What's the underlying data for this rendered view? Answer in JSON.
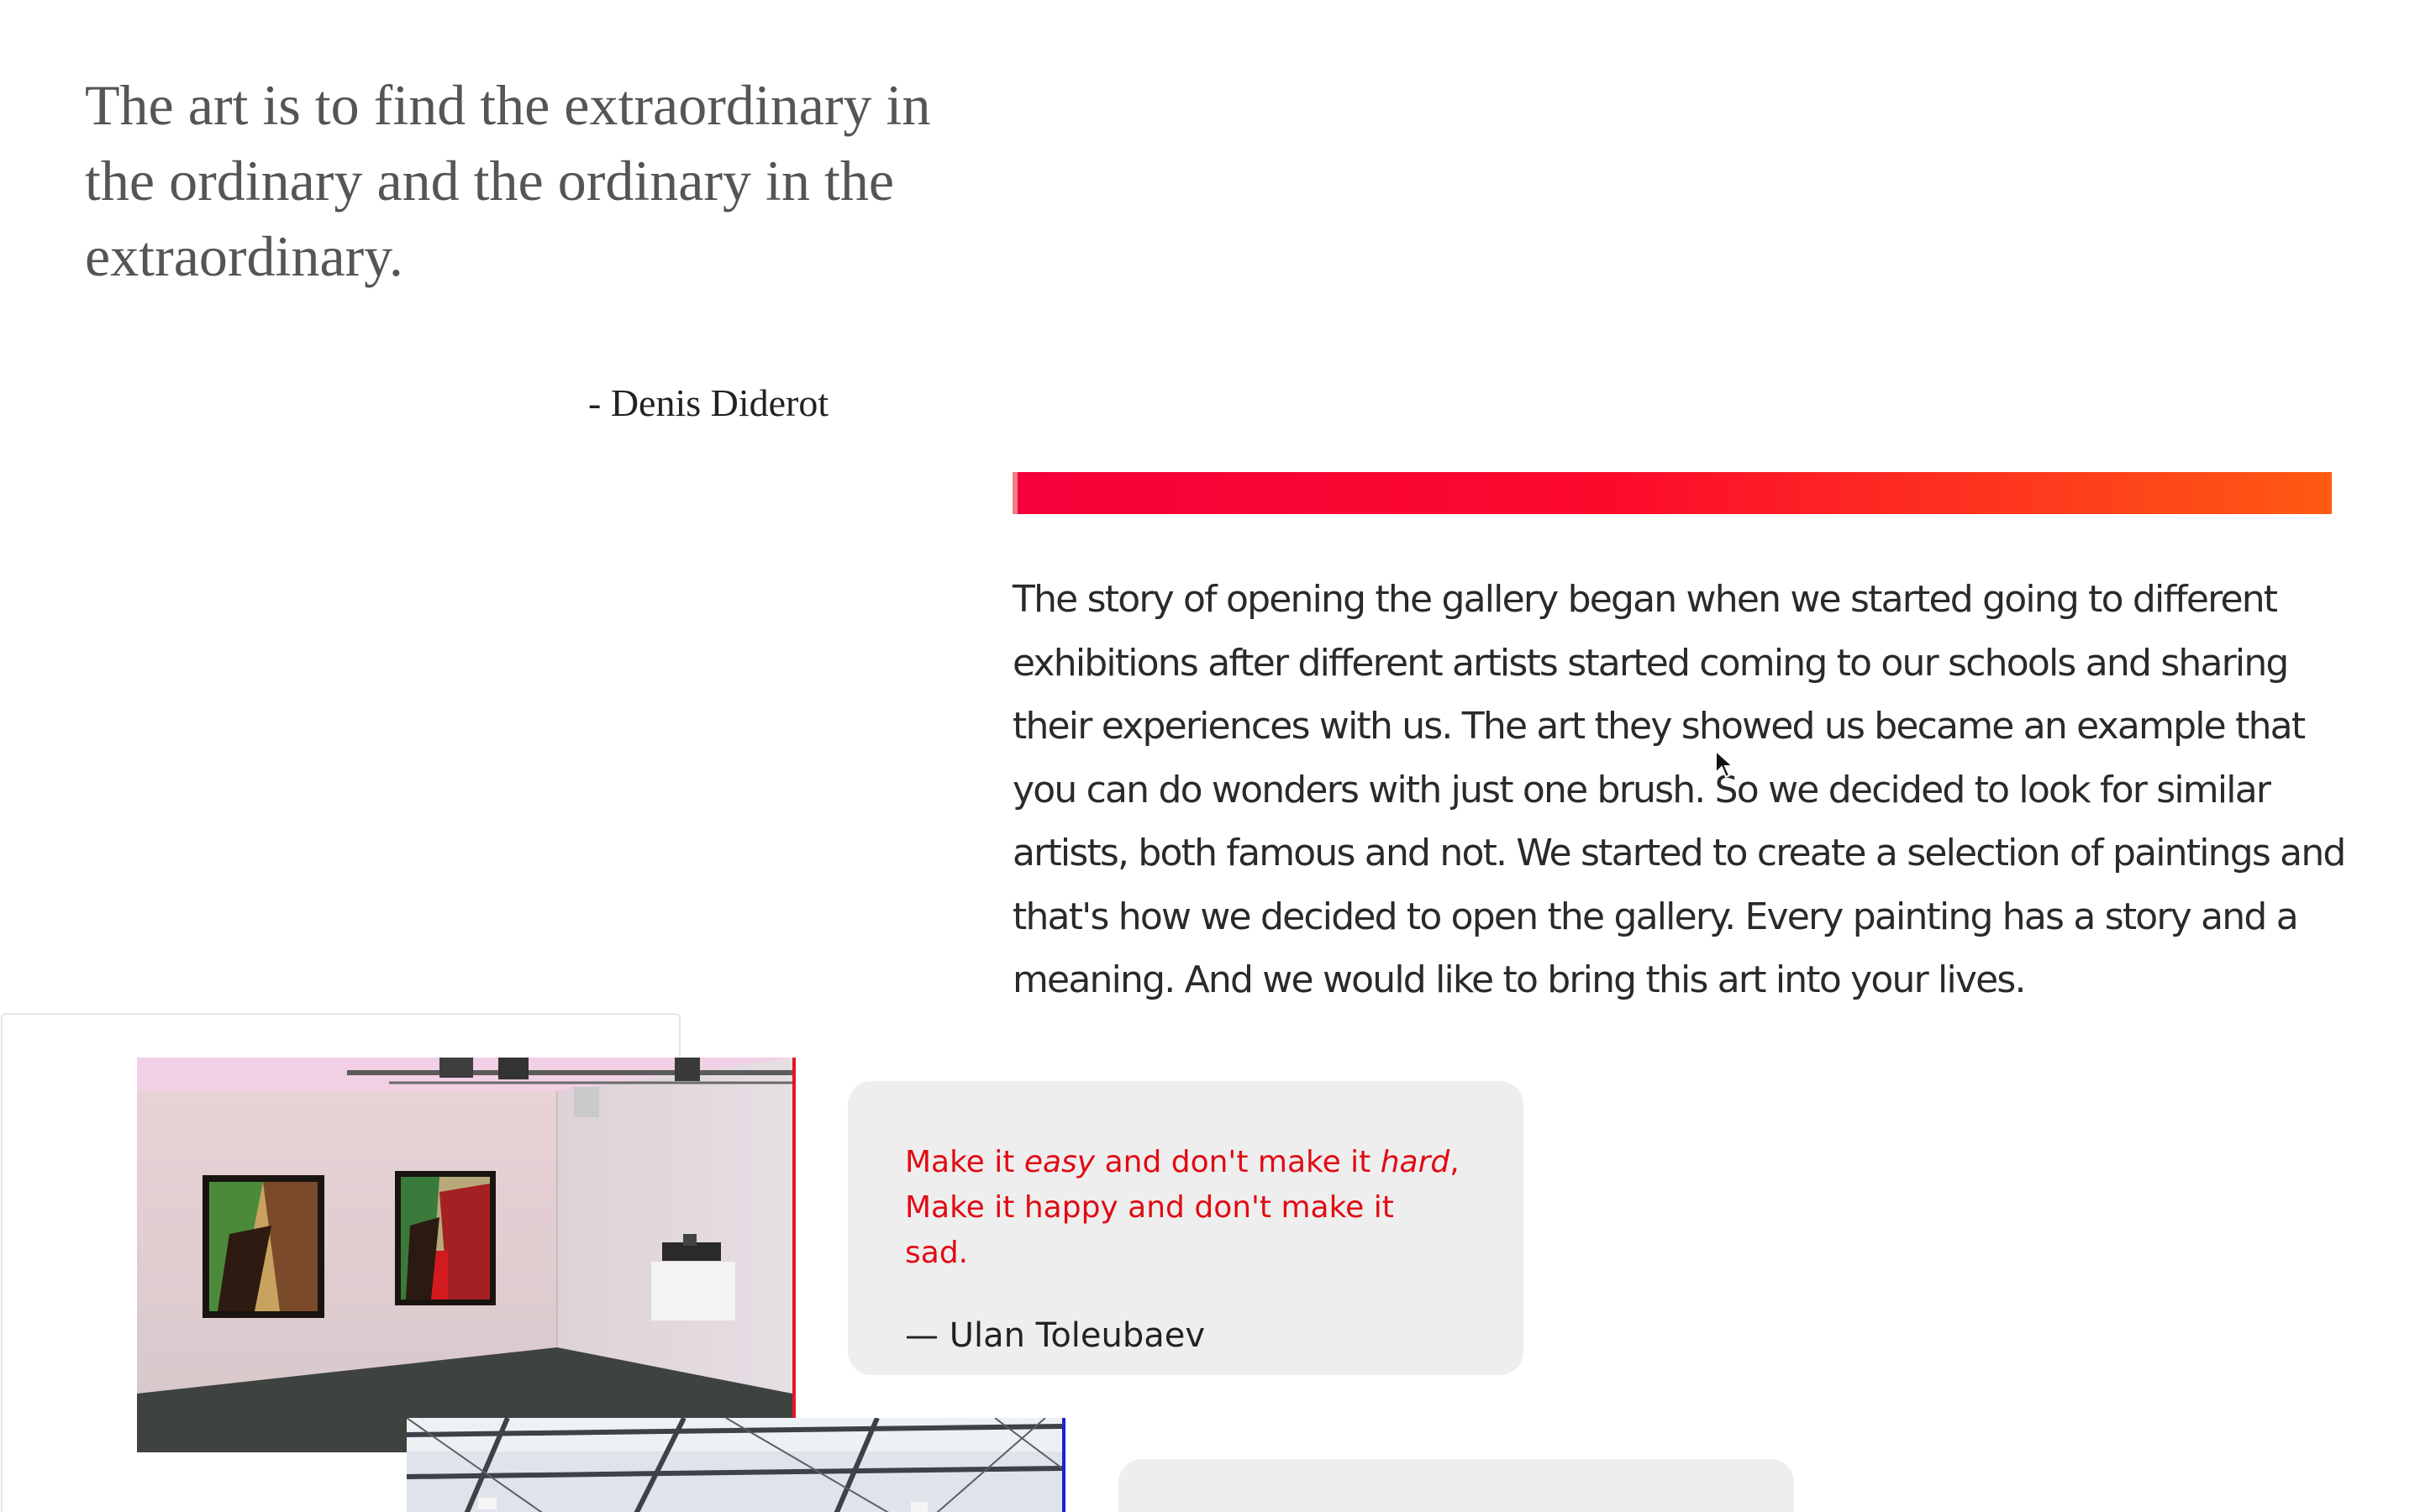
{
  "hero_quote": {
    "text": "The art is to find the extraordinary in the ordinary and the ordinary in the extraordinary.",
    "author": "- Denis Diderot"
  },
  "story": {
    "text": "The story of opening the gallery began when we started going to different exhibitions after different artists started coming to our schools and sharing their experiences with us. The art they showed us became an example that you can do wonders with just one brush. So we decided to look for similar artists, both famous and not. We started to create a selection of paintings and that's how we decided to open the gallery. Every painting has a story and a meaning. And we would like to bring this art into your lives."
  },
  "cards": [
    {
      "quote_part_1": "Make it ",
      "quote_em_1": "easy",
      "quote_part_2": " and don't make it ",
      "quote_em_2": "hard",
      "quote_part_3": ",",
      "quote_line_2": "Make it happy and don't make it sad.",
      "author": "— Ulan Toleubaev"
    }
  ],
  "colors": {
    "accent_red": "#e10b13",
    "gradient_start": "#f5003a",
    "gradient_end": "#ff5a12",
    "photo_border_1": "#e51626",
    "photo_border_2": "#1b22cf",
    "card_bg": "#eeeeee"
  },
  "icons": {
    "cursor": "mouse-pointer-icon"
  }
}
